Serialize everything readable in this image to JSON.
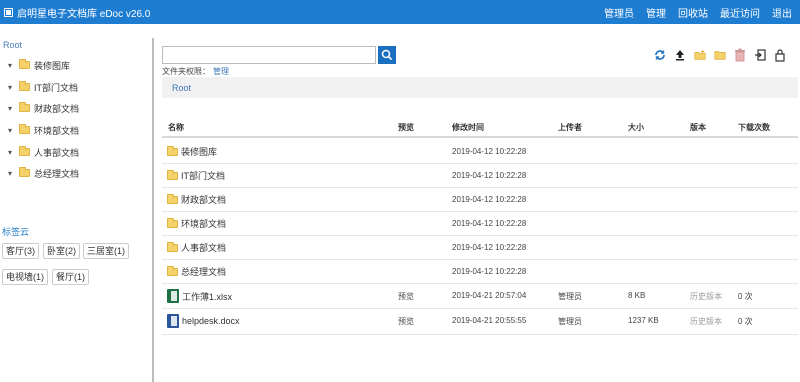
{
  "app": {
    "title": "启明星电子文档库 eDoc v26.0",
    "nav": [
      "管理员",
      "管理",
      "回收站",
      "最近访问",
      "退出"
    ]
  },
  "sidebar": {
    "root_label": "Root",
    "tree_items": [
      "装修图库",
      "IT部门文档",
      "财政部文档",
      "环境部文档",
      "人事部文档",
      "总经理文档"
    ],
    "tags_title": "标签云",
    "tags": [
      "客厅(3)",
      "卧室(2)",
      "三居室(1)",
      "电视墙(1)",
      "餐厅(1)"
    ]
  },
  "search": {
    "value": "",
    "placeholder": ""
  },
  "permission": {
    "label": "文件夹权限：",
    "value": "管理"
  },
  "breadcrumb": {
    "root": "Root"
  },
  "toolbar_icons": [
    "refresh-icon",
    "upload-icon",
    "new-folder-icon",
    "folder-icon",
    "delete-icon",
    "import-icon",
    "lock-icon"
  ],
  "table": {
    "headers": [
      "名称",
      "预览",
      "修改时间",
      "上传者",
      "大小",
      "版本",
      "下载次数"
    ],
    "rows": [
      {
        "type": "folder",
        "name": "装修图库",
        "preview": "",
        "modified": "2019-04-12 10:22:28",
        "uploader": "",
        "size": "",
        "version": "",
        "downloads": ""
      },
      {
        "type": "folder",
        "name": "IT部门文档",
        "preview": "",
        "modified": "2019-04-12 10:22:28",
        "uploader": "",
        "size": "",
        "version": "",
        "downloads": ""
      },
      {
        "type": "folder",
        "name": "财政部文档",
        "preview": "",
        "modified": "2019-04-12 10:22:28",
        "uploader": "",
        "size": "",
        "version": "",
        "downloads": ""
      },
      {
        "type": "folder",
        "name": "环境部文档",
        "preview": "",
        "modified": "2019-04-12 10:22:28",
        "uploader": "",
        "size": "",
        "version": "",
        "downloads": ""
      },
      {
        "type": "folder",
        "name": "人事部文档",
        "preview": "",
        "modified": "2019-04-12 10:22:28",
        "uploader": "",
        "size": "",
        "version": "",
        "downloads": ""
      },
      {
        "type": "folder",
        "name": "总经理文档",
        "preview": "",
        "modified": "2019-04-12 10:22:28",
        "uploader": "",
        "size": "",
        "version": "",
        "downloads": ""
      },
      {
        "type": "xlsx",
        "name": "工作薄1.xlsx",
        "preview": "预览",
        "modified": "2019-04-21 20:57:04",
        "uploader": "管理员",
        "size": "8 KB",
        "version": "历史版本",
        "downloads": "0 次"
      },
      {
        "type": "docx",
        "name": "helpdesk.docx",
        "preview": "预览",
        "modified": "2019-04-21 20:55:55",
        "uploader": "管理员",
        "size": "1237 KB",
        "version": "历史版本",
        "downloads": "0 次"
      }
    ]
  },
  "colors": {
    "topbar": "#1e7dd1",
    "search_button": "#1b6fc0",
    "link": "#3b78b8",
    "folder": "#f5d16a"
  }
}
